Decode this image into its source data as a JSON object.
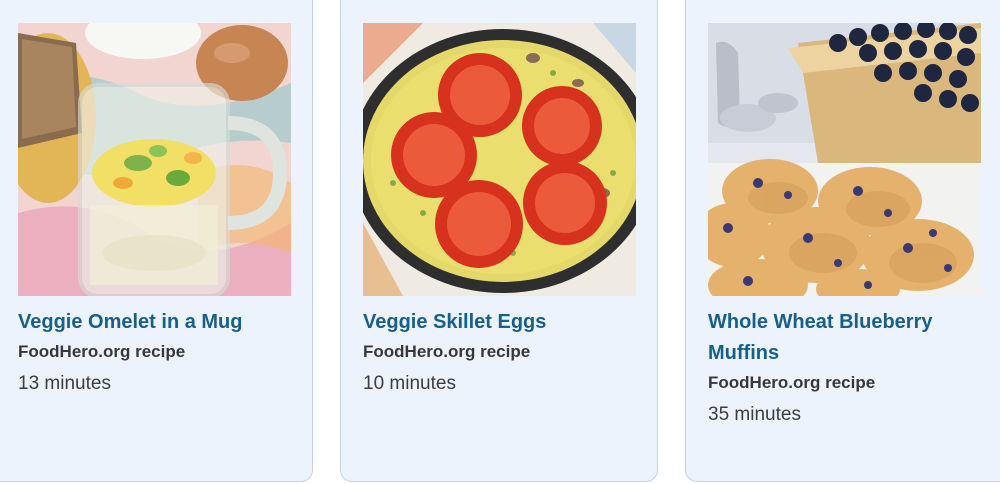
{
  "recipes": [
    {
      "title": "Veggie Omelet in a Mug",
      "source": "FoodHero.org recipe",
      "time": "13 minutes"
    },
    {
      "title": "Veggie Skillet Eggs",
      "source": "FoodHero.org recipe",
      "time": "10 minutes"
    },
    {
      "title": "Whole Wheat Blueberry Muffins",
      "source": "FoodHero.org recipe",
      "time": "35 minutes"
    }
  ],
  "colors": {
    "card_background": "#ecf3fd",
    "title_link": "#175f8c",
    "source_text": "#383838",
    "time_text": "#3d3d3d"
  }
}
